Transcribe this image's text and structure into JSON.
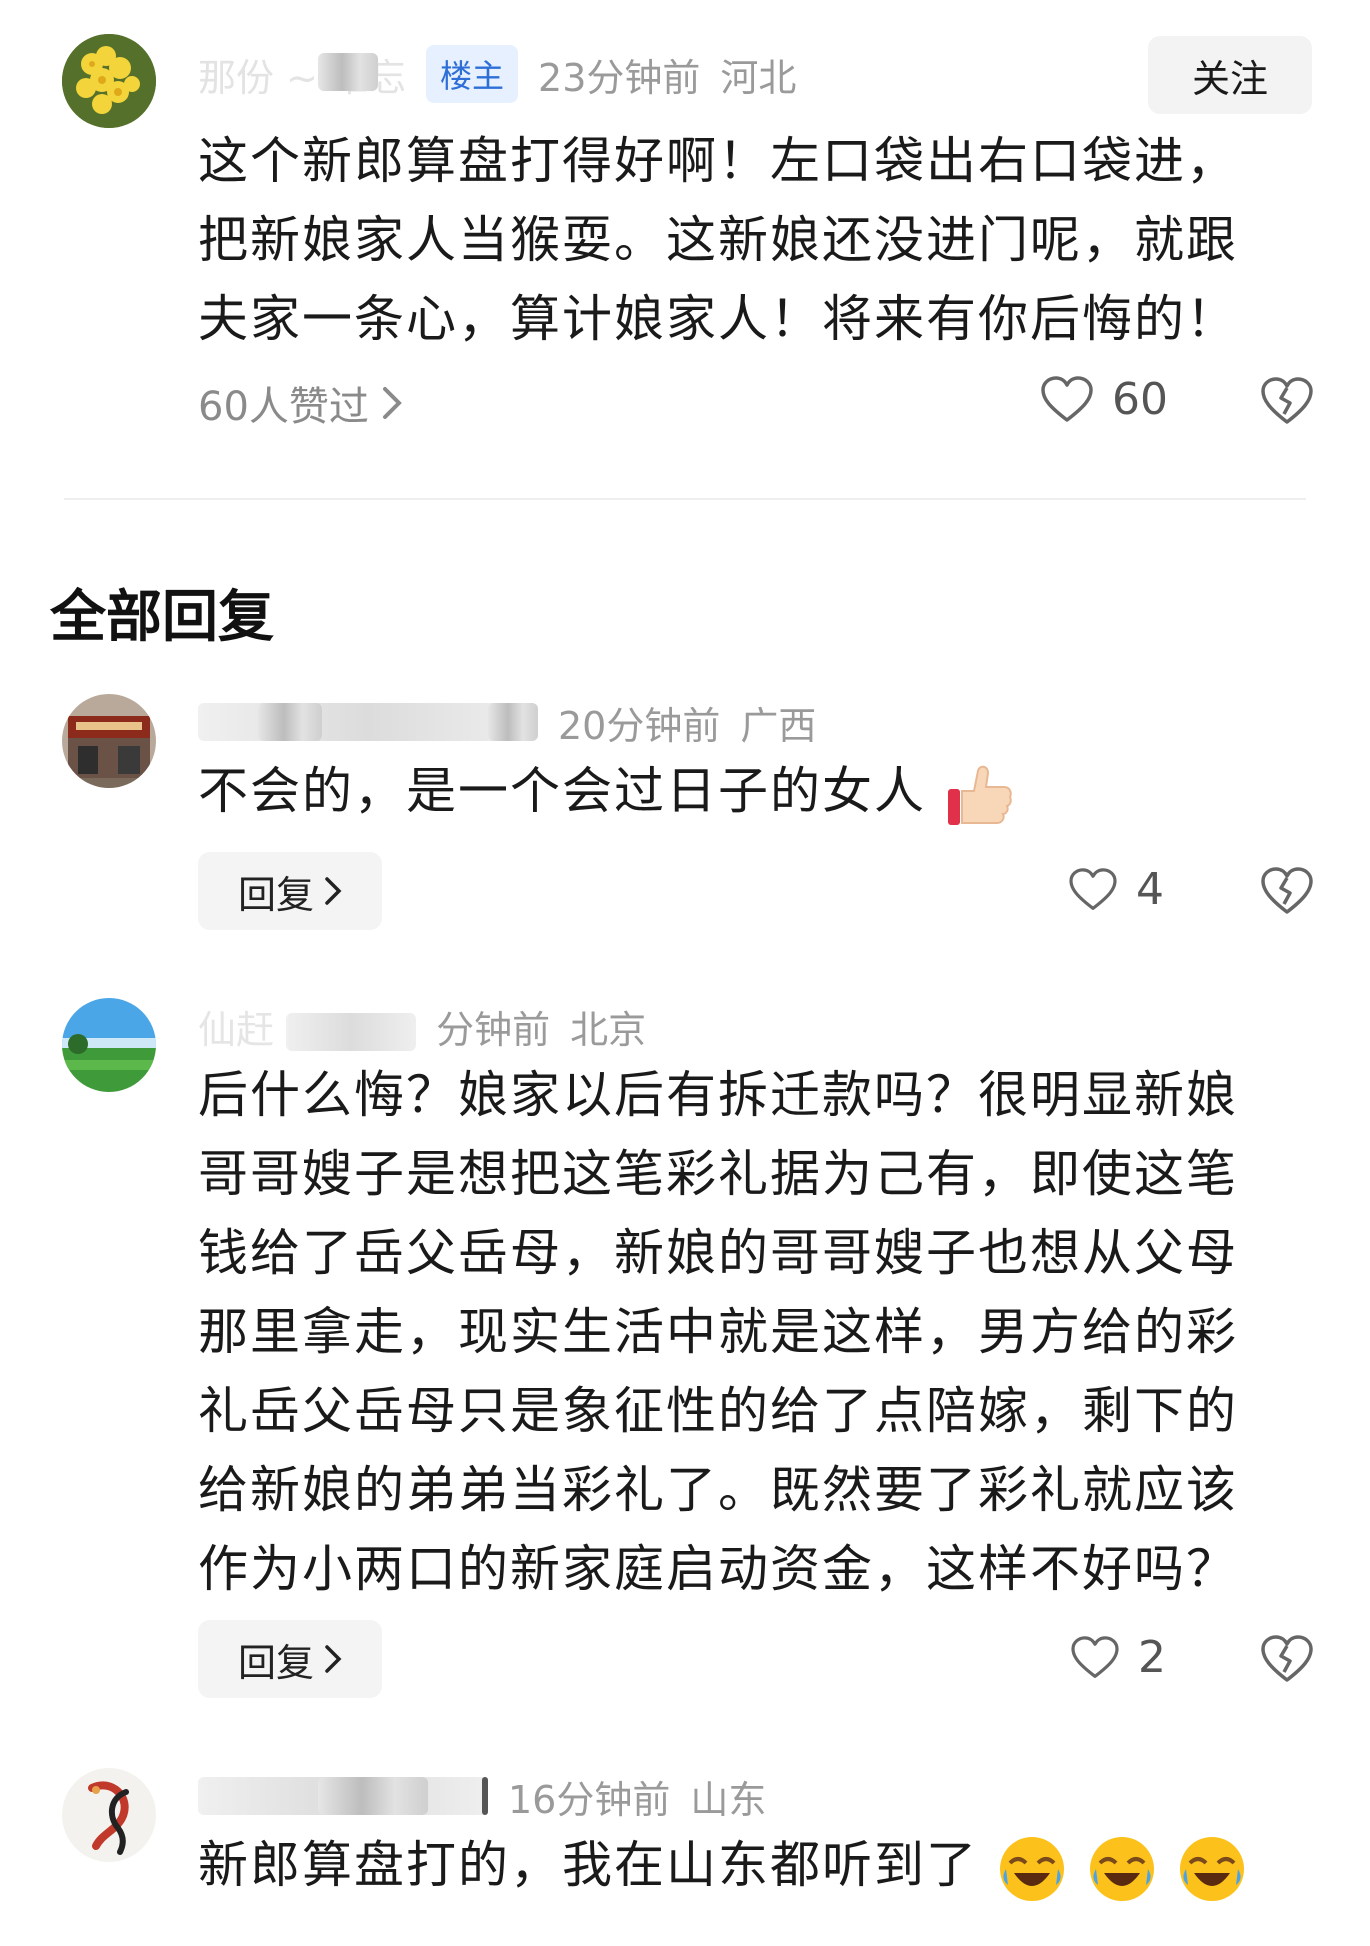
{
  "main_comment": {
    "avatar_icon": "yellow-flower-avatar",
    "username": "那份 ~ 难忘",
    "badge": "楼主",
    "time": "23分钟前",
    "location": "河北",
    "follow_label": "关注",
    "text": "这个新郎算盘打得好啊！左口袋出右口袋进，把新娘家人当猴耍。这新娘还没进门呢，就跟夫家一条心，算计娘家人！将来有你后悔的！",
    "likes_summary": "60人赞过",
    "like_count": "60"
  },
  "section_title": "全部回复",
  "replies": [
    {
      "avatar_icon": "restaurant-storefront-avatar",
      "time": "20分钟前",
      "location": "广西",
      "text": "不会的，是一个会过日子的女人",
      "emoji": "thumbs-up-emoji",
      "reply_label": "回复",
      "like_count": "4"
    },
    {
      "avatar_icon": "green-field-avatar",
      "username_partial": "仙赶",
      "time": "分钟前",
      "location": "北京",
      "text": "后什么悔？娘家以后有拆迁款吗？很明显新娘哥哥嫂子是想把这笔彩礼据为己有，即使这笔钱给了岳父岳母，新娘的哥哥嫂子也想从父母那里拿走，现实生活中就是这样，男方给的彩礼岳父岳母只是象征性的给了点陪嫁，剩下的给新娘的弟弟当彩礼了。既然要了彩礼就应该作为小两口的新家庭启动资金，这样不好吗？",
      "reply_label": "回复",
      "like_count": "2"
    },
    {
      "avatar_icon": "koi-fish-avatar",
      "time": "16分钟前",
      "location": "山东",
      "text": "新郎算盘打的，我在山东都听到了",
      "emoji": "rolling-laughing-emoji"
    }
  ],
  "colors": {
    "text": "#1a1a1a",
    "meta": "#9a9a9a",
    "badge_bg": "#e6f0ff",
    "badge_text": "#2d6fd6",
    "button_bg": "#f4f4f4"
  }
}
